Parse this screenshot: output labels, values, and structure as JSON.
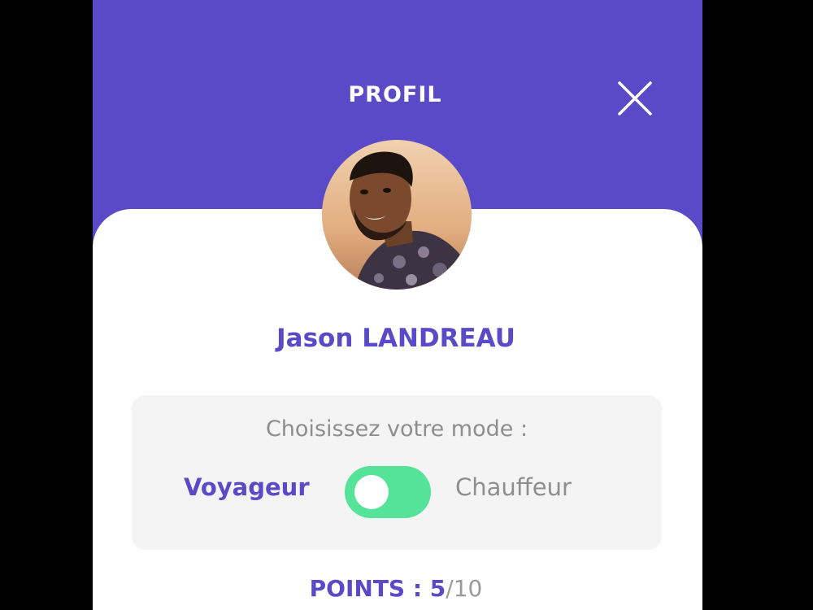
{
  "header": {
    "title": "PROFIL",
    "close_icon": "close-icon"
  },
  "profile": {
    "name": "Jason LANDREAU",
    "avatar": "user-photo"
  },
  "mode": {
    "prompt": "Choisissez votre mode :",
    "options": [
      "Voyageur",
      "Chauffeur"
    ],
    "selected": "Voyageur",
    "toggle_color": "#55e39a"
  },
  "points": {
    "label": "POINTS : ",
    "value": "5",
    "separator": "/",
    "max": "10"
  },
  "colors": {
    "primary": "#5b4ac8",
    "muted": "#8e8e8e",
    "panel": "#f4f4f4"
  }
}
